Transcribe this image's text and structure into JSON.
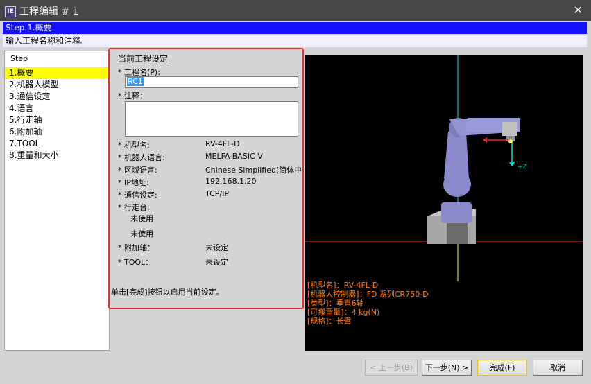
{
  "window": {
    "title": "工程编辑 # 1",
    "app_icon": "IE",
    "close_icon": "✕"
  },
  "step_header": "Step.1.概要",
  "step_description": "输入工程名称和注释。",
  "steps": {
    "header": "Step",
    "items": [
      {
        "label": "1.概要",
        "selected": true
      },
      {
        "label": "2.机器人模型",
        "selected": false
      },
      {
        "label": "3.通信设定",
        "selected": false
      },
      {
        "label": "4.语言",
        "selected": false
      },
      {
        "label": "5.行走轴",
        "selected": false
      },
      {
        "label": "6.附加轴",
        "selected": false
      },
      {
        "label": "7.TOOL",
        "selected": false
      },
      {
        "label": "8.重量和大小",
        "selected": false
      }
    ]
  },
  "settings": {
    "title": "当前工程设定",
    "project_name_label": "* 工程名(P):",
    "project_name_value": "RC1",
    "comment_label": "* 注释：",
    "fields": [
      {
        "label": "* 机型名:",
        "value": "RV-4FL-D"
      },
      {
        "label": "* 机器人语言:",
        "value": "MELFA-BASIC V"
      },
      {
        "label": "* 区域语言:",
        "value": "Chinese Simplified(简体中"
      },
      {
        "label": "* IP地址:",
        "value": "192.168.1.20"
      },
      {
        "label": "* 通信设定:",
        "value": "TCP/IP"
      }
    ],
    "traveling_label": "* 行走台:",
    "traveling_values": [
      "未使用",
      "未使用"
    ],
    "additional_axis_label": "* 附加轴：",
    "additional_axis_value": "未设定",
    "tool_label": "* TOOL：",
    "tool_value": "未设定",
    "hint": "单击[完成]按钮以启用当前设定。"
  },
  "viewer": {
    "axis_label_z": "+Z",
    "info": [
      "[机型名]：RV-4FL-D",
      "[机器人控制器]：FD 系列CR750-D",
      "[类型]：垂直6轴",
      "[可搬重量]：4 kg(N)",
      "[规格]：长臂"
    ],
    "colors": {
      "info_text": "#ff7b1a",
      "robot_body": "#8b8bcc",
      "axis_red": "#ff2020",
      "axis_cyan": "#00e0e0",
      "axis_yellow": "#ffff40"
    }
  },
  "buttons": {
    "back": "< 上一步(B)",
    "next": "下一步(N) >",
    "finish": "完成(F)",
    "cancel": "取消"
  }
}
